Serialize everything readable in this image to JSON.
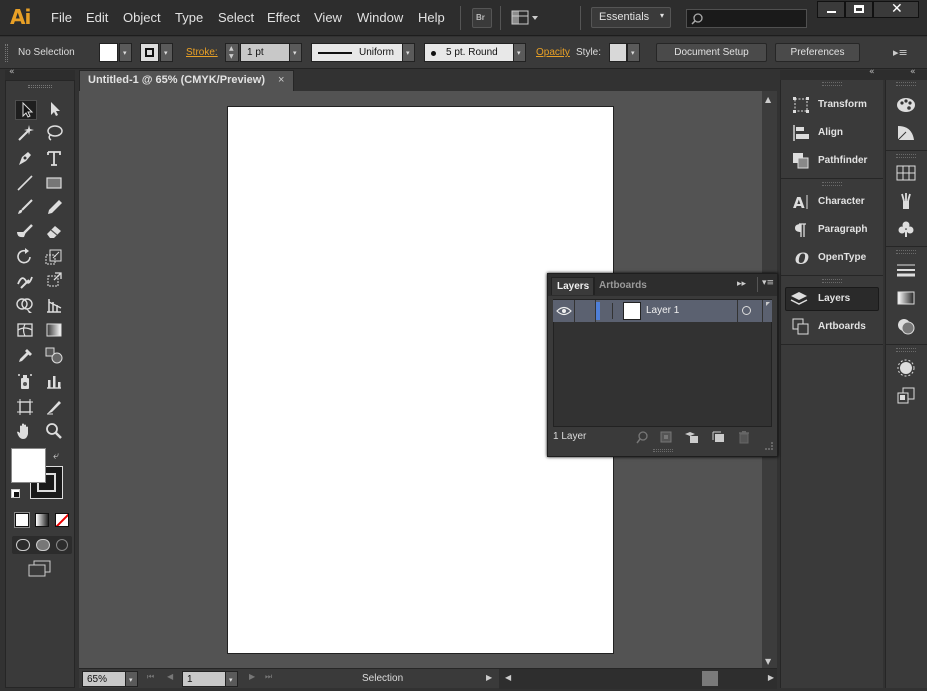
{
  "app": {
    "logo": "Ai"
  },
  "menu": [
    "File",
    "Edit",
    "Object",
    "Type",
    "Select",
    "Effect",
    "View",
    "Window",
    "Help"
  ],
  "menubar_right": {
    "bridge_label": "Br",
    "workspace": "Essentials",
    "search_placeholder": ""
  },
  "control": {
    "selection": "No Selection",
    "stroke_label": "Stroke:",
    "stroke_weight": "1 pt",
    "profile": "Uniform",
    "brush": "5 pt. Round",
    "opacity_label": "Opacity",
    "style_label": "Style:",
    "document_setup": "Document Setup",
    "preferences": "Preferences"
  },
  "document": {
    "tab_title": "Untitled-1 @ 65% (CMYK/Preview)",
    "close_glyph": "×"
  },
  "status": {
    "zoom": "65%",
    "page": "1",
    "mode": "Selection"
  },
  "dock": {
    "groups": [
      [
        "Transform",
        "Align",
        "Pathfinder"
      ],
      [
        "Character",
        "Paragraph",
        "OpenType"
      ],
      [
        "Layers",
        "Artboards"
      ]
    ],
    "active": "Layers"
  },
  "layers_panel": {
    "tabs": [
      "Layers",
      "Artboards"
    ],
    "layers": [
      {
        "name": "Layer 1",
        "color": "#4f7fd8"
      }
    ],
    "count_label": "1 Layer"
  },
  "colors": {
    "accent": "#e8a026",
    "panel": "#3a3a3a",
    "canvas": "#535353",
    "artboard": "#ffffff",
    "selected_row": "#5b6170",
    "layer_color": "#4f7fd8"
  },
  "icons": {
    "tools": [
      [
        "selection-tool-icon",
        "direct-selection-tool-icon"
      ],
      [
        "magic-wand-tool-icon",
        "lasso-tool-icon"
      ],
      [
        "pen-tool-icon",
        "type-tool-icon"
      ],
      [
        "line-segment-tool-icon",
        "rectangle-tool-icon"
      ],
      [
        "paintbrush-tool-icon",
        "pencil-tool-icon"
      ],
      [
        "blob-brush-tool-icon",
        "eraser-tool-icon"
      ],
      [
        "rotate-tool-icon",
        "scale-tool-icon"
      ],
      [
        "warp-tool-icon",
        "free-transform-tool-icon"
      ],
      [
        "shape-builder-tool-icon",
        "graph-tool-icon"
      ],
      [
        "mesh-tool-icon",
        "gradient-tool-icon"
      ],
      [
        "eyedropper-tool-icon",
        "blend-tool-icon"
      ],
      [
        "symbol-sprayer-tool-icon",
        "column-graph-tool-icon"
      ],
      [
        "artboard-tool-icon",
        "slice-tool-icon"
      ],
      [
        "hand-tool-icon",
        "zoom-tool-icon"
      ]
    ]
  }
}
